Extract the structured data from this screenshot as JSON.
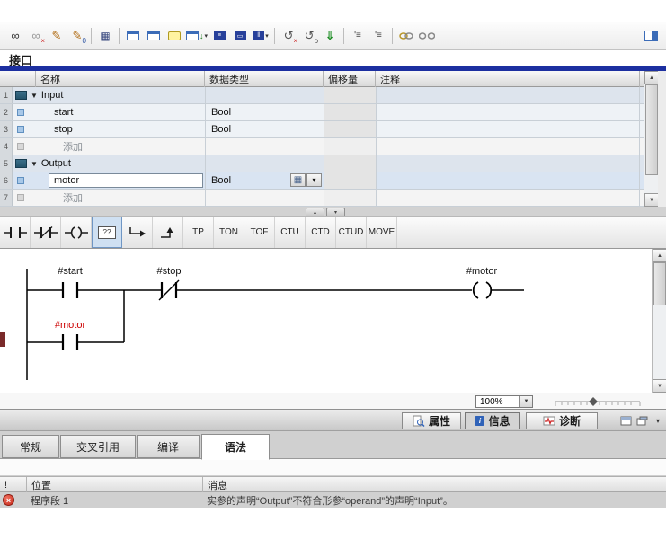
{
  "colors": {
    "pane_blue_bar": "#1c2fa0",
    "selection_blue": "#2f62b8",
    "error_red": "#c62818",
    "red_operand_label": "#cc0000"
  },
  "icons": {
    "monitor_all": "∞",
    "monitor_off": "∞",
    "cross_overlay": "×",
    "modify": "✎",
    "snapshot": "▦",
    "menu_lines": "≡",
    "box": "▭",
    "split": "‖",
    "undo": "↺",
    "small_o": "o",
    "zero": "0",
    "down_arrow_small": "↓",
    "download": "⇓",
    "compare": "'≡",
    "dropdown": "▾",
    "expand_tri": "▼",
    "tri_up": "▴",
    "tri_down": "▾",
    "scroll_up": "▲",
    "scroll_down": "▼",
    "grid": "▦",
    "error_x": "×",
    "info_i": "i",
    "exclamation": "!"
  },
  "interface": {
    "title": "接口",
    "columns": {
      "name": "名称",
      "datatype": "数据类型",
      "offset": "偏移量",
      "comment": "注释"
    },
    "rows": [
      {
        "num": "1",
        "name": "Input",
        "type": ""
      },
      {
        "num": "2",
        "name": "start",
        "type": "Bool"
      },
      {
        "num": "3",
        "name": "stop",
        "type": "Bool"
      },
      {
        "num": "4",
        "name": "添加",
        "type": ""
      },
      {
        "num": "5",
        "name": "Output",
        "type": ""
      },
      {
        "num": "6",
        "name": "motor",
        "type": "Bool"
      },
      {
        "num": "7",
        "name": "添加",
        "type": ""
      }
    ]
  },
  "instructions": {
    "empty_box_label": "??",
    "tp": "TP",
    "ton": "TON",
    "tof": "TOF",
    "ctu": "CTU",
    "ctd": "CTD",
    "ctud": "CTUD",
    "move": "MOVE"
  },
  "ladder": {
    "start_label": "#start",
    "stop_label": "#stop",
    "coil_label": "#motor",
    "branch_label": "#motor"
  },
  "zoom": {
    "level": "100%"
  },
  "inspector_tabs": {
    "properties": "属性",
    "info": "信息",
    "diagnostics": "诊断"
  },
  "result_tabs": {
    "general": "常规",
    "cross_ref": "交叉引用",
    "compile": "编译",
    "syntax": "语法"
  },
  "messages": {
    "columns": {
      "flag": "!",
      "location": "位置",
      "message": "消息"
    },
    "row": {
      "location": "程序段 1",
      "message": "实参的声明“Output”不符合形参“operand”的声明“Input”。"
    }
  }
}
